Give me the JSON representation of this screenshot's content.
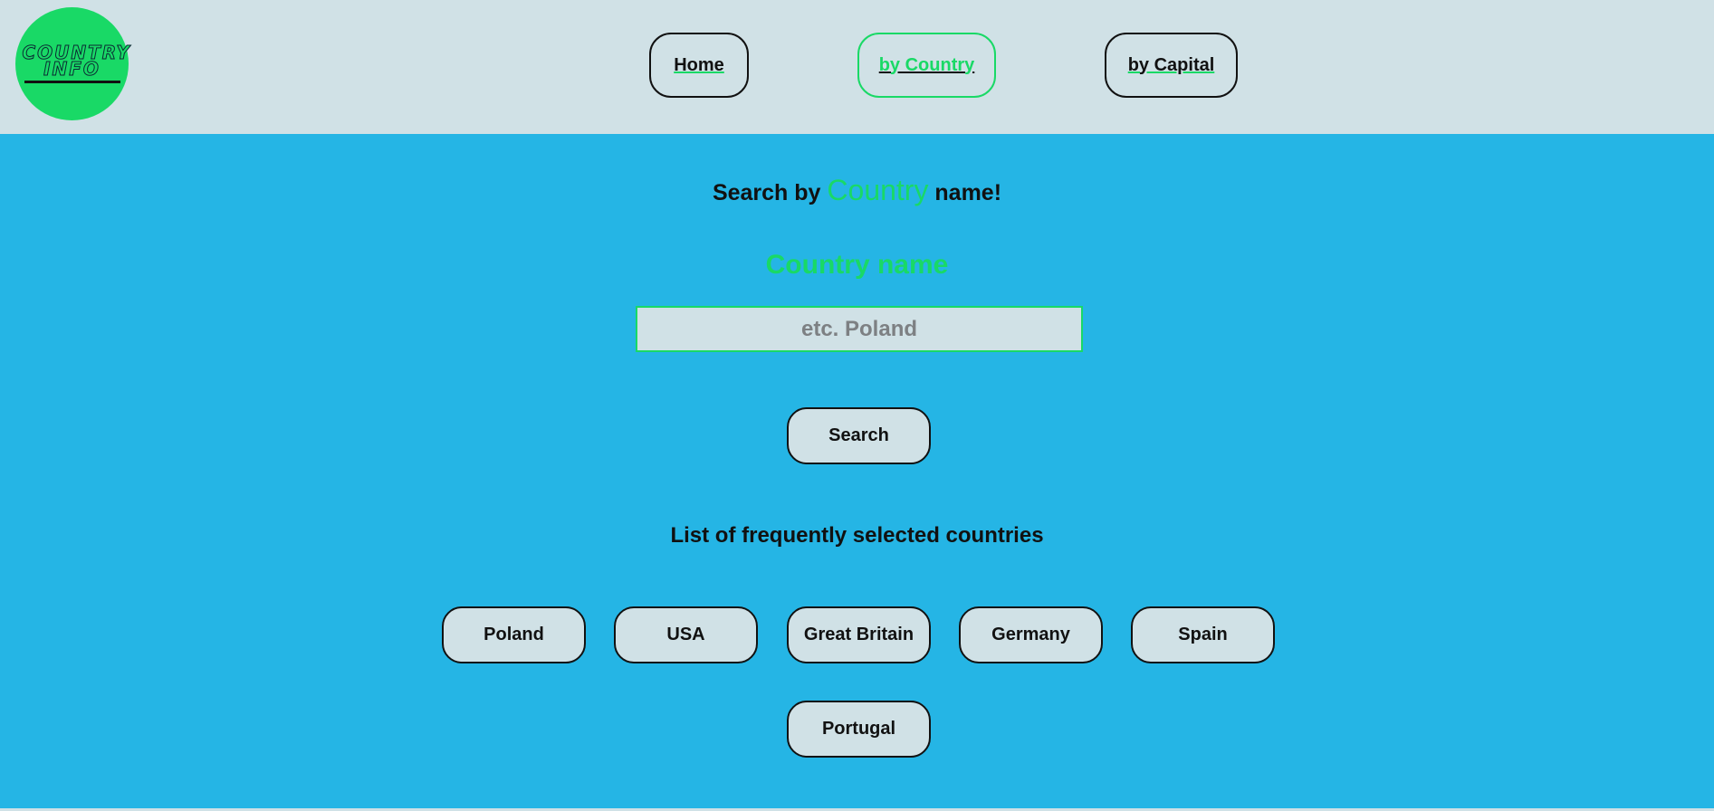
{
  "logo": {
    "line1": "COUNTRY",
    "line2": "INFO"
  },
  "nav": {
    "home": "Home",
    "by_country": "by Country",
    "by_capital": "by Capital"
  },
  "main": {
    "title_prefix": "Search by",
    "title_accent": "Country",
    "title_suffix": "name!",
    "field_label": "Country name",
    "search_placeholder": "etc. Poland",
    "search_value": "",
    "search_button": "Search",
    "list_title": "List of frequently selected countries",
    "countries": [
      "Poland",
      "USA",
      "Great Britain",
      "Germany",
      "Spain",
      "Portugal"
    ]
  },
  "colors": {
    "accent": "#19d966",
    "header_bg": "#d0e1e6",
    "main_bg": "#25b5e5",
    "border": "#111111"
  }
}
